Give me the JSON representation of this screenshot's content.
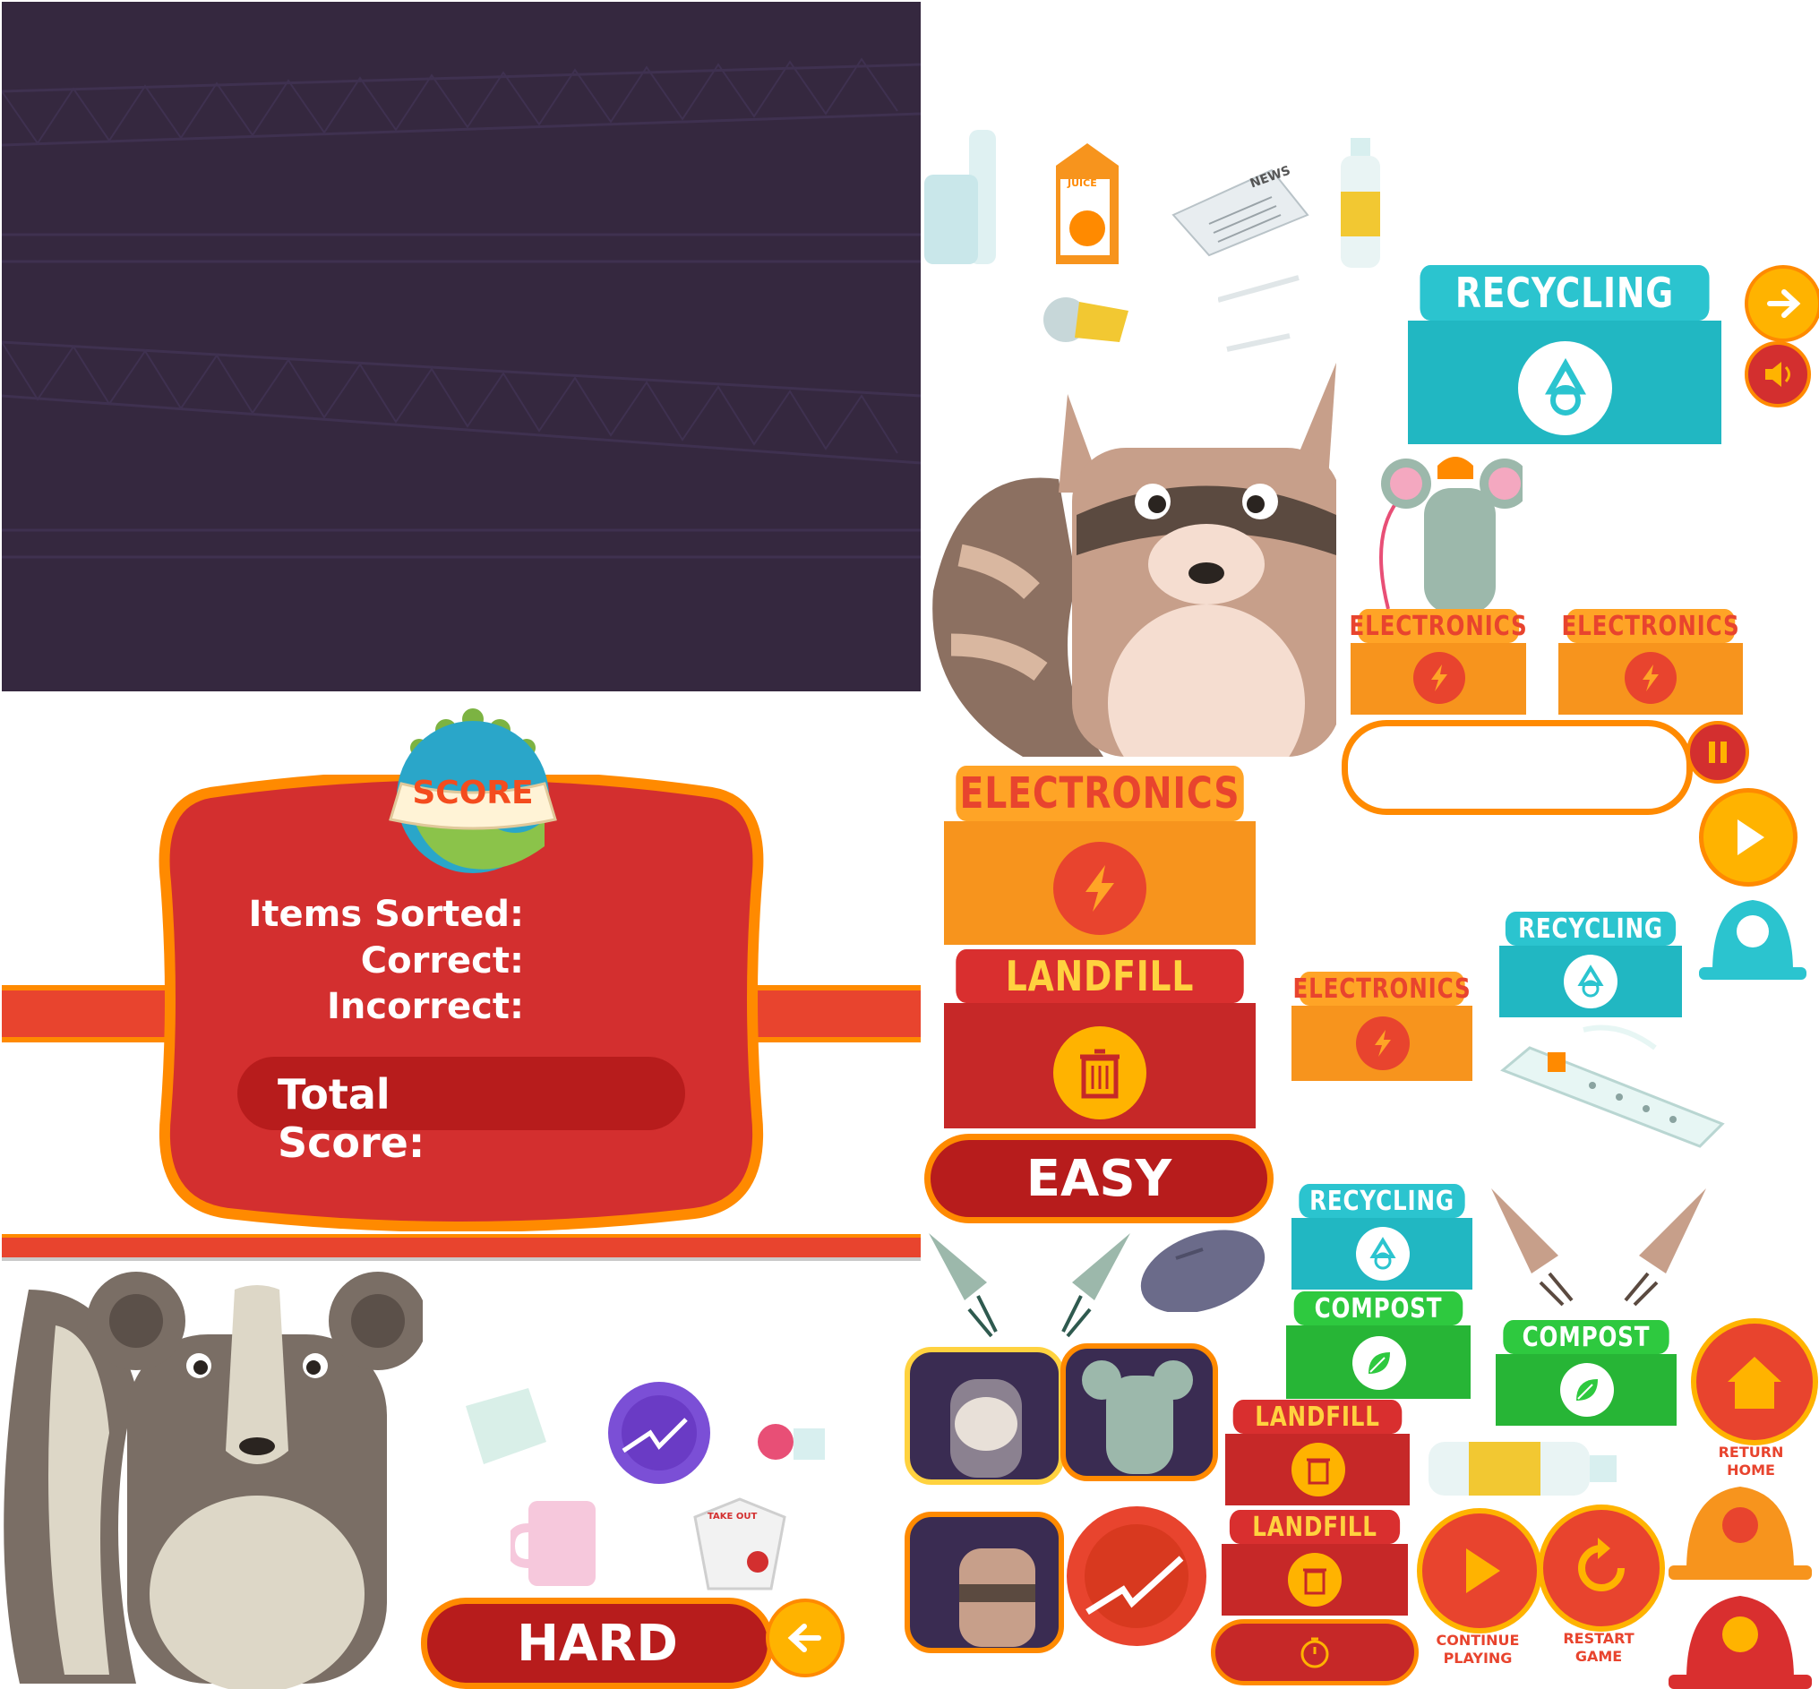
{
  "background": {
    "color": "#35283f",
    "line_color": "#3f3150"
  },
  "score_panel": {
    "badge_label": "SCORE",
    "lines": [
      "Items Sorted:",
      "Correct:",
      "Incorrect:"
    ],
    "total_label": "Total Score:"
  },
  "bins": {
    "recycling_large": "RECYCLING",
    "electronics_small_1": "ELECTRONICS",
    "electronics_small_2": "ELECTRONICS",
    "electronics_large": "ELECTRONICS",
    "landfill_large": "LANDFILL",
    "electronics_medium": "ELECTRONICS",
    "recycling_medium": "RECYCLING",
    "recycling_small": "RECYCLING",
    "compost_1": "COMPOST",
    "compost_2": "COMPOST",
    "landfill_small_1": "LANDFILL",
    "landfill_small_2": "LANDFILL"
  },
  "buttons": {
    "easy": "EASY",
    "hard": "HARD",
    "return_home": "RETURN HOME",
    "continue_playing": "CONTINUE PLAYING",
    "restart_game": "RESTART GAME"
  },
  "items": {
    "juice_label": "JUICE",
    "news_label": "NEWS",
    "takeout_label": "TAKE OUT"
  },
  "colors": {
    "recycling": "#2bc4cf",
    "electronics": "#f7941d",
    "landfill": "#d92f2f",
    "compost": "#2ec93f",
    "orange_accent": "#ff8a00",
    "score_red": "#d32f2f"
  },
  "icons": [
    "recycle-icon",
    "lightning-icon",
    "trash-icon",
    "leaf-icon",
    "arrow-right-icon",
    "speaker-icon",
    "pause-icon",
    "play-icon",
    "home-icon",
    "restart-icon",
    "stopwatch-icon",
    "arrow-left-icon"
  ]
}
